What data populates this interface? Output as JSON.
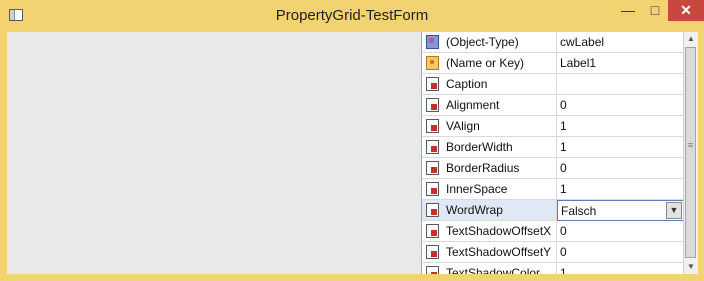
{
  "window": {
    "title": "PropertyGrid-TestForm"
  },
  "controls": {
    "minimize": "—",
    "maximize": "□",
    "close": "✕"
  },
  "grid": {
    "rows": [
      {
        "name": "(Object-Type)",
        "value": "cwLabel",
        "icon": "object-type-icon"
      },
      {
        "name": "(Name or Key)",
        "value": "Label1",
        "icon": "key-icon"
      },
      {
        "name": "Caption",
        "value": "",
        "icon": "property-icon"
      },
      {
        "name": "Alignment",
        "value": "0",
        "icon": "property-icon"
      },
      {
        "name": "VAlign",
        "value": "1",
        "icon": "property-icon"
      },
      {
        "name": "BorderWidth",
        "value": "1",
        "icon": "property-icon"
      },
      {
        "name": "BorderRadius",
        "value": "0",
        "icon": "property-icon"
      },
      {
        "name": "InnerSpace",
        "value": "1",
        "icon": "property-icon"
      },
      {
        "name": "WordWrap",
        "value": "Falsch",
        "icon": "property-icon",
        "selected": true
      },
      {
        "name": "TextShadowOffsetX",
        "value": "0",
        "icon": "property-icon"
      },
      {
        "name": "TextShadowOffsetY",
        "value": "0",
        "icon": "property-icon"
      },
      {
        "name": "TextShadowColor",
        "value": "1",
        "icon": "property-icon"
      }
    ]
  },
  "scrollbar": {
    "up": "▲",
    "down": "▼",
    "grip": "≡"
  }
}
